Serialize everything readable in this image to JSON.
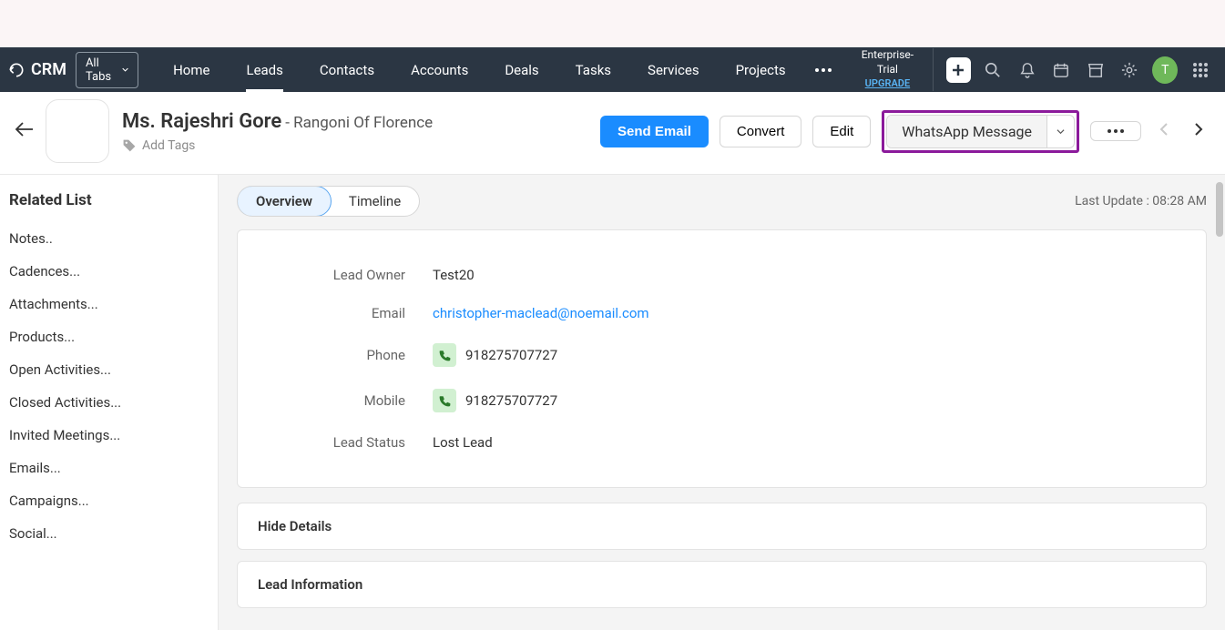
{
  "brand": "CRM",
  "all_tabs_label": "All Tabs",
  "nav": [
    "Home",
    "Leads",
    "Contacts",
    "Accounts",
    "Deals",
    "Tasks",
    "Services",
    "Projects"
  ],
  "active_nav_index": 1,
  "enterprise": {
    "line1": "Enterprise-Trial",
    "upgrade": "UPGRADE"
  },
  "avatar_letter": "T",
  "lead": {
    "name": "Ms. Rajeshri Gore",
    "company_prefix": " - ",
    "company": "Rangoni Of Florence",
    "add_tags": "Add Tags"
  },
  "actions": {
    "send_email": "Send Email",
    "convert": "Convert",
    "edit": "Edit",
    "whatsapp": "WhatsApp Message"
  },
  "sidebar": {
    "title": "Related List",
    "items": [
      "Notes..",
      "Cadences...",
      "Attachments...",
      "Products...",
      "Open Activities...",
      "Closed Activities...",
      "Invited Meetings...",
      "Emails...",
      "Campaigns...",
      "Social..."
    ]
  },
  "tabs": {
    "overview": "Overview",
    "timeline": "Timeline"
  },
  "last_update": "Last Update : 08:28 AM",
  "fields": {
    "lead_owner": {
      "label": "Lead Owner",
      "value": "Test20"
    },
    "email": {
      "label": "Email",
      "value": "christopher-maclead@noemail.com"
    },
    "phone": {
      "label": "Phone",
      "value": "918275707727"
    },
    "mobile": {
      "label": "Mobile",
      "value": "918275707727"
    },
    "lead_status": {
      "label": "Lead Status",
      "value": "Lost Lead"
    }
  },
  "sections": {
    "hide_details": "Hide Details",
    "lead_info": "Lead Information"
  }
}
